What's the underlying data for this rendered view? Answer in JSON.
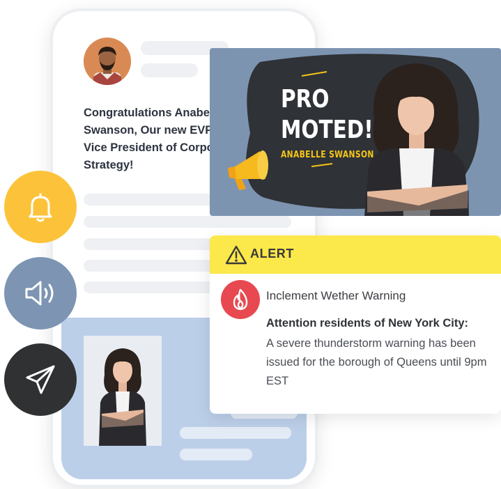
{
  "post": {
    "text": "Congratulations Anabelle\nSwanson, Our new EVP\nVice President of Corporate\nStrategy!"
  },
  "promo": {
    "title": "PRO\nMOTED!",
    "name": "ANABELLE SWANSON"
  },
  "alert": {
    "label": "ALERT",
    "title": "Inclement Wether Warning",
    "lead": "Attention residents of New York City:",
    "body": "A severe thunderstorm warning has been issued for the borough of Queens until 9pm EST"
  },
  "icons": {
    "bell": "bell-icon",
    "speaker": "speaker-icon",
    "send": "send-icon",
    "warning": "warning-icon",
    "fire": "fire-icon",
    "megaphone": "megaphone-icon"
  },
  "colors": {
    "bell_circle": "#fcc33a",
    "speaker_circle": "#7d95b2",
    "send_circle": "#2f3133",
    "promo_bg": "#7d94b1",
    "promo_accent": "#f5c518",
    "alert_header": "#fbe84a",
    "fire_badge": "#e8484f",
    "panel_blue": "#bccfe9"
  }
}
